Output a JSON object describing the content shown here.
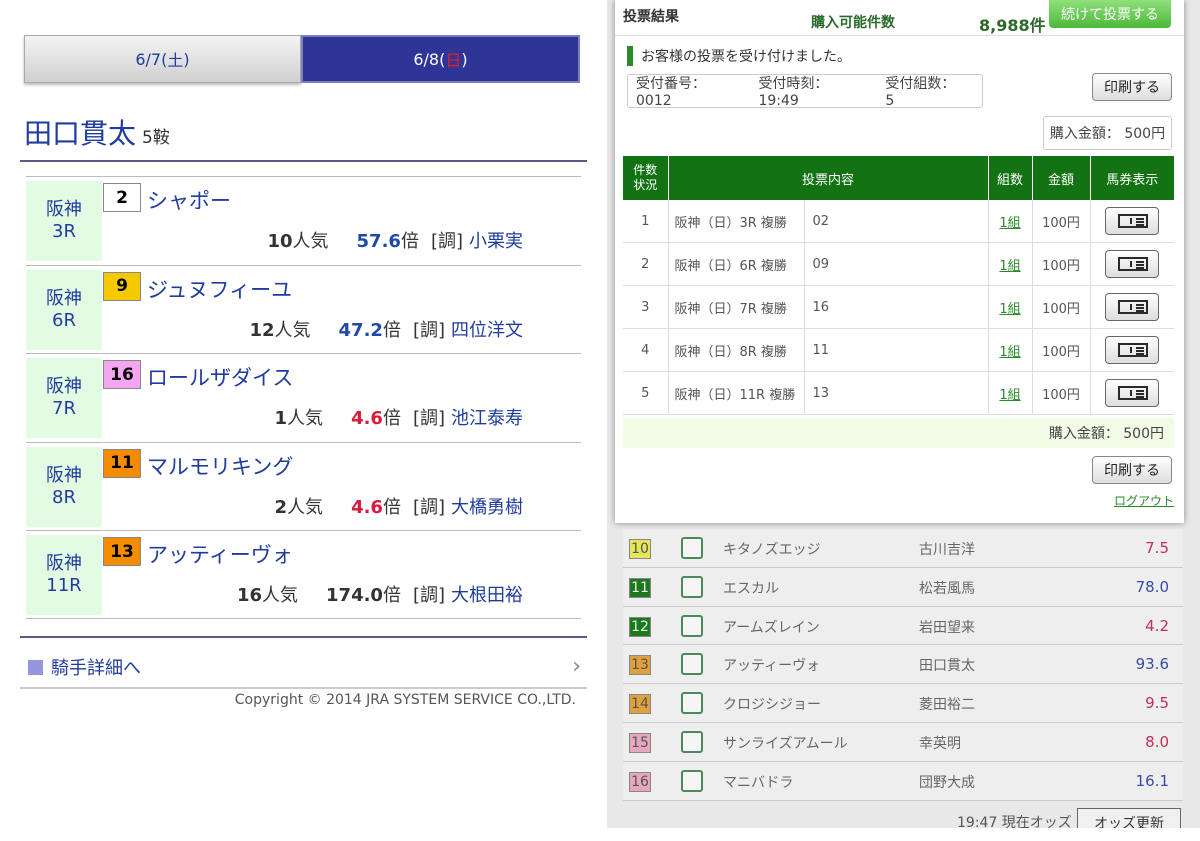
{
  "left": {
    "tabs": [
      {
        "date": "6/7(",
        "dow": "土",
        "close": ")"
      },
      {
        "date": "6/8(",
        "dow": "日",
        "close": ")"
      }
    ],
    "jockey": {
      "name": "田口貫太",
      "rides": "5鞍"
    },
    "rides": [
      {
        "venue": "阪神",
        "race": "3R",
        "num": "2",
        "numBg": "#ffffff",
        "horse": "シャポー",
        "pop": "10",
        "popSuffix": "人気",
        "odds": "57.6",
        "oddsColor": "#1f4aa8",
        "bai": "倍",
        "cho": "[調]",
        "trainer": "小栗実"
      },
      {
        "venue": "阪神",
        "race": "6R",
        "num": "9",
        "numBg": "#f5c800",
        "horse": "ジュヌフィーユ",
        "pop": "12",
        "popSuffix": "人気",
        "odds": "47.2",
        "oddsColor": "#1f4aa8",
        "bai": "倍",
        "cho": "[調]",
        "trainer": "四位洋文"
      },
      {
        "venue": "阪神",
        "race": "7R",
        "num": "16",
        "numBg": "#f4a6f0",
        "horse": "ロールザダイス",
        "pop": "1",
        "popSuffix": "人気",
        "odds": "4.6",
        "oddsColor": "#d81b3c",
        "bai": "倍",
        "cho": "[調]",
        "trainer": "池江泰寿"
      },
      {
        "venue": "阪神",
        "race": "8R",
        "num": "11",
        "numBg": "#f58c00",
        "horse": "マルモリキング",
        "pop": "2",
        "popSuffix": "人気",
        "odds": "4.6",
        "oddsColor": "#d81b3c",
        "bai": "倍",
        "cho": "[調]",
        "trainer": "大橋勇樹"
      },
      {
        "venue": "阪神",
        "race": "11R",
        "num": "13",
        "numBg": "#f58c00",
        "horse": "アッティーヴォ",
        "pop": "16",
        "popSuffix": "人気",
        "odds": "174.0",
        "oddsColor": "#333333",
        "bai": "倍",
        "cho": "[調]",
        "trainer": "大根田裕"
      }
    ],
    "jockey_link": "騎手詳細へ",
    "copyright": "Copyright © 2014 JRA SYSTEM SERVICE CO.,LTD."
  },
  "right": {
    "modal": {
      "title": "投票結果",
      "available_label": "購入可能件数",
      "available_value": "8,988件",
      "continue_btn": "続けて投票する",
      "accepted_msg": "お客様の投票を受け付けました。",
      "receipt": {
        "no": "受付番号： 0012",
        "time": "受付時刻： 19:49",
        "sets": "受付組数： 5"
      },
      "print_label": "印刷する",
      "amount": "購入金額： 500円",
      "headers": [
        "件数\n状況",
        "投票内容",
        "組数",
        "金額",
        "馬券表示"
      ],
      "bets": [
        {
          "idx": "1",
          "content": "阪神（日）3R 複勝",
          "sel": "02",
          "sets": "1組",
          "amt": "100円"
        },
        {
          "idx": "2",
          "content": "阪神（日）6R 複勝",
          "sel": "09",
          "sets": "1組",
          "amt": "100円"
        },
        {
          "idx": "3",
          "content": "阪神（日）7R 複勝",
          "sel": "16",
          "sets": "1組",
          "amt": "100円"
        },
        {
          "idx": "4",
          "content": "阪神（日）8R 複勝",
          "sel": "11",
          "sets": "1組",
          "amt": "100円"
        },
        {
          "idx": "5",
          "content": "阪神（日）11R 複勝",
          "sel": "13",
          "sets": "1組",
          "amt": "100円"
        }
      ],
      "logout": "ログアウト"
    },
    "odds": [
      {
        "n": "10",
        "bg": "#e6e65a",
        "fg": "#555",
        "horse": "キタノズエッジ",
        "jockey": "古川吉洋",
        "odds": "7.5",
        "oddsColor": "#c03050"
      },
      {
        "n": "11",
        "bg": "#1c7a1c",
        "fg": "#eee",
        "horse": "エスカル",
        "jockey": "松若風馬",
        "odds": "78.0",
        "oddsColor": "#3a4aa8"
      },
      {
        "n": "12",
        "bg": "#1c7a1c",
        "fg": "#eee",
        "horse": "アームズレイン",
        "jockey": "岩田望来",
        "odds": "4.2",
        "oddsColor": "#c03050"
      },
      {
        "n": "13",
        "bg": "#e0a040",
        "fg": "#555",
        "horse": "アッティーヴォ",
        "jockey": "田口貫太",
        "odds": "93.6",
        "oddsColor": "#3a4aa8"
      },
      {
        "n": "14",
        "bg": "#e0a040",
        "fg": "#555",
        "horse": "クロジシジョー",
        "jockey": "菱田裕二",
        "odds": "9.5",
        "oddsColor": "#c03050"
      },
      {
        "n": "15",
        "bg": "#e6a6c0",
        "fg": "#555",
        "horse": "サンライズアムール",
        "jockey": "幸英明",
        "odds": "8.0",
        "oddsColor": "#c03050"
      },
      {
        "n": "16",
        "bg": "#e6a6c0",
        "fg": "#555",
        "horse": "マニバドラ",
        "jockey": "団野大成",
        "odds": "16.1",
        "oddsColor": "#3a4aa8"
      }
    ],
    "footer_time": "19:47 現在オッズ",
    "odds_update": "オッズ更新"
  }
}
